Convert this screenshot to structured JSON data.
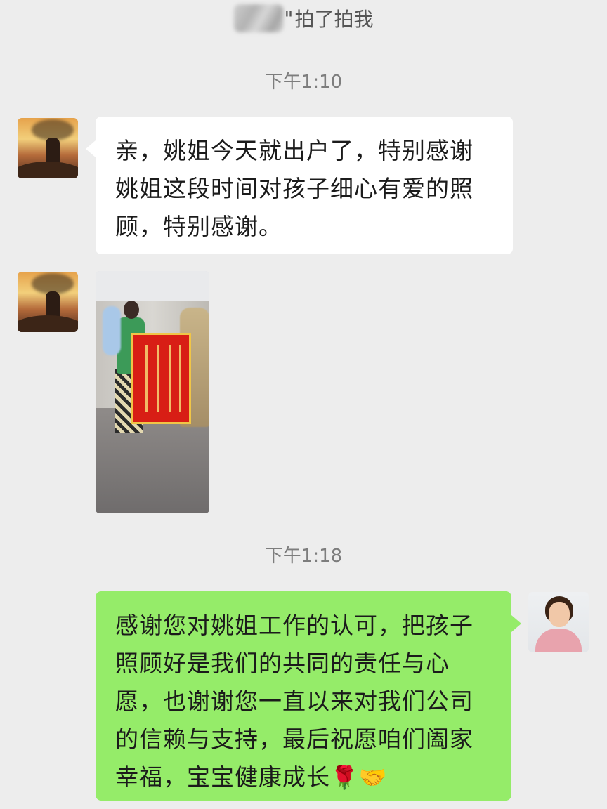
{
  "pat_notice": {
    "masked_name_suffix": "\"",
    "text": "拍了拍我"
  },
  "timestamps": {
    "first": "下午1:10",
    "second": "下午1:18"
  },
  "messages": [
    {
      "side": "left",
      "text": "亲，姚姐今天就出户了，特别感谢姚姐这段时间对孩子细心有爱的照顾，特别感谢。"
    },
    {
      "side": "left",
      "type": "image",
      "image_label": "family-with-banner-photo"
    },
    {
      "side": "right",
      "text": "感谢您对姚姐工作的认可，把孩子照顾好是我们的共同的责任与心愿，也谢谢您一直以来对我们公司的信赖与支持，最后祝愿咱们阖家幸福，宝宝健康成长",
      "emoji": [
        "🌹",
        "🤝"
      ]
    }
  ],
  "colors": {
    "background": "#ededed",
    "incoming_bubble": "#ffffff",
    "outgoing_bubble": "#95ec69",
    "system_text": "#7d7d7d"
  }
}
